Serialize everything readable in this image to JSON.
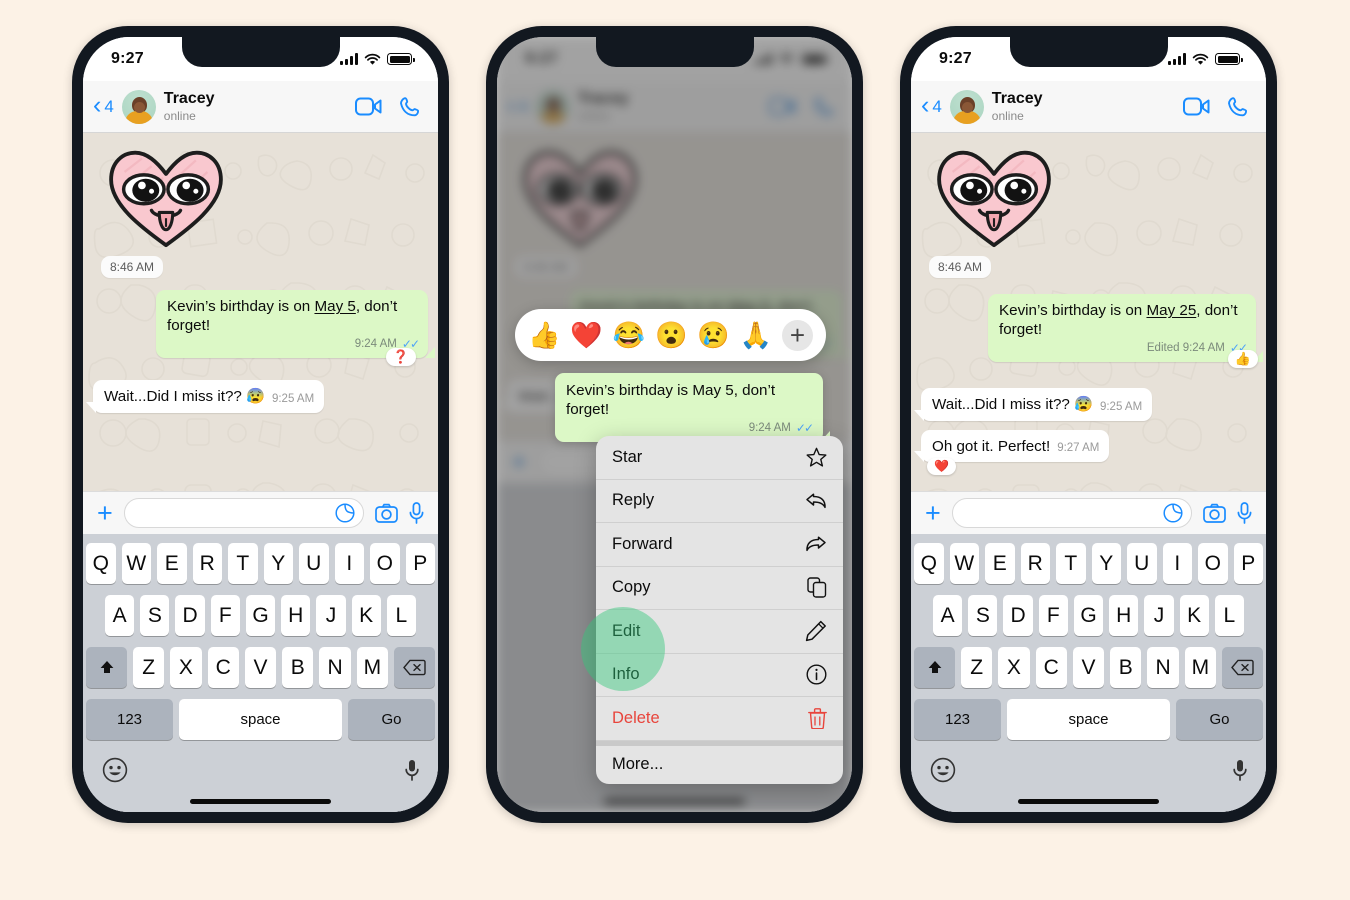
{
  "page": {
    "background_color": "#FCF2E6",
    "title": "WhatsApp message edit feature walkthrough"
  },
  "theme": {
    "accent_blue": "#1A8CFF",
    "outgoing_bubble": "#DCF8C6",
    "incoming_bubble": "#FFFFFF",
    "chat_wallpaper": "#E7E1D8",
    "tick_blue": "#4FA3F7",
    "delete_red": "#E8453C",
    "tap_highlight": "#34C77B"
  },
  "status_bar": {
    "time": "9:27",
    "signal_icon": "cellular-bars-icon",
    "wifi_icon": "wifi-icon",
    "battery_icon": "battery-full-icon"
  },
  "chat_header": {
    "back_icon": "chevron-left-icon",
    "unread_count": "4",
    "avatar_name": "contact-avatar",
    "contact_name": "Tracey",
    "presence": "online",
    "video_call_icon": "video-camera-icon",
    "voice_call_icon": "phone-icon"
  },
  "sticker": {
    "name": "heart-face-sticker",
    "description": "Pink heart with cartoon eyes and tongue"
  },
  "day_time_pill": "8:46 AM",
  "phone1": {
    "label": "phone-before-edit",
    "messages": [
      {
        "id": "msg-birthday-original",
        "direction": "out",
        "text_before": "Kevin’s birthday is  on ",
        "text_underlined": "May 5",
        "text_after": ", don’t forget!",
        "time": "9:24 AM",
        "ticks": "✓✓",
        "reaction": "❓"
      },
      {
        "id": "msg-wait-did-i-miss",
        "direction": "in",
        "text": "Wait...Did I miss it?? 😰",
        "time": "9:25 AM"
      }
    ]
  },
  "phone2": {
    "label": "phone-context-menu",
    "emoji_reactions": [
      {
        "name": "thumbs-up-emoji",
        "glyph": "👍"
      },
      {
        "name": "red-heart-emoji",
        "glyph": "❤️"
      },
      {
        "name": "joy-emoji",
        "glyph": "😂"
      },
      {
        "name": "surprised-emoji",
        "glyph": "😮"
      },
      {
        "name": "crying-emoji",
        "glyph": "😢"
      },
      {
        "name": "folded-hands-emoji",
        "glyph": "🙏"
      }
    ],
    "emoji_add_label": "+",
    "selected_message": {
      "text_before": "Kevin’s birthday is ",
      "text_underlined": "May 5",
      "text_after": ", don’t forget!",
      "time": "9:24 AM",
      "ticks": "✓✓"
    },
    "context_menu": [
      {
        "label": "Star",
        "icon": "star-icon",
        "danger": false
      },
      {
        "label": "Reply",
        "icon": "reply-icon",
        "danger": false
      },
      {
        "label": "Forward",
        "icon": "forward-icon",
        "danger": false
      },
      {
        "label": "Copy",
        "icon": "copy-icon",
        "danger": false
      },
      {
        "label": "Edit",
        "icon": "pencil-icon",
        "danger": false
      },
      {
        "label": "Info",
        "icon": "info-icon",
        "danger": false
      },
      {
        "label": "Delete",
        "icon": "trash-icon",
        "danger": true
      },
      {
        "label": "More...",
        "icon": "none",
        "danger": false
      }
    ],
    "tap_target": "Edit"
  },
  "phone3": {
    "label": "phone-after-edit",
    "messages": [
      {
        "id": "msg-birthday-edited",
        "direction": "out",
        "text_before": "Kevin’s birthday is  on ",
        "text_underlined": "May 25",
        "text_after": ", don’t forget!",
        "time": "Edited 9:24 AM",
        "ticks": "✓✓",
        "reaction": "👍"
      },
      {
        "id": "msg-wait-did-i-miss",
        "direction": "in",
        "text": "Wait...Did I miss it?? 😰",
        "time": "9:25 AM"
      },
      {
        "id": "msg-oh-got-it",
        "direction": "in",
        "text": "Oh got it. Perfect!",
        "time": "9:27 AM",
        "reaction": "❤️"
      }
    ]
  },
  "input_bar": {
    "plus_icon": "plus-icon",
    "placeholder": "",
    "value": "",
    "sticker_icon": "sticker-icon",
    "camera_icon": "camera-icon",
    "mic_icon": "microphone-icon"
  },
  "keyboard": {
    "row1": [
      "Q",
      "W",
      "E",
      "R",
      "T",
      "Y",
      "U",
      "I",
      "O",
      "P"
    ],
    "row2": [
      "A",
      "S",
      "D",
      "F",
      "G",
      "H",
      "J",
      "K",
      "L"
    ],
    "row3": [
      "Z",
      "X",
      "C",
      "V",
      "B",
      "N",
      "M"
    ],
    "shift_icon": "shift-arrow-icon",
    "backspace_icon": "backspace-icon",
    "numbers_key": "123",
    "space_key": "space",
    "go_key": "Go",
    "emoji_icon": "smiley-icon",
    "dictation_icon": "microphone-icon"
  }
}
